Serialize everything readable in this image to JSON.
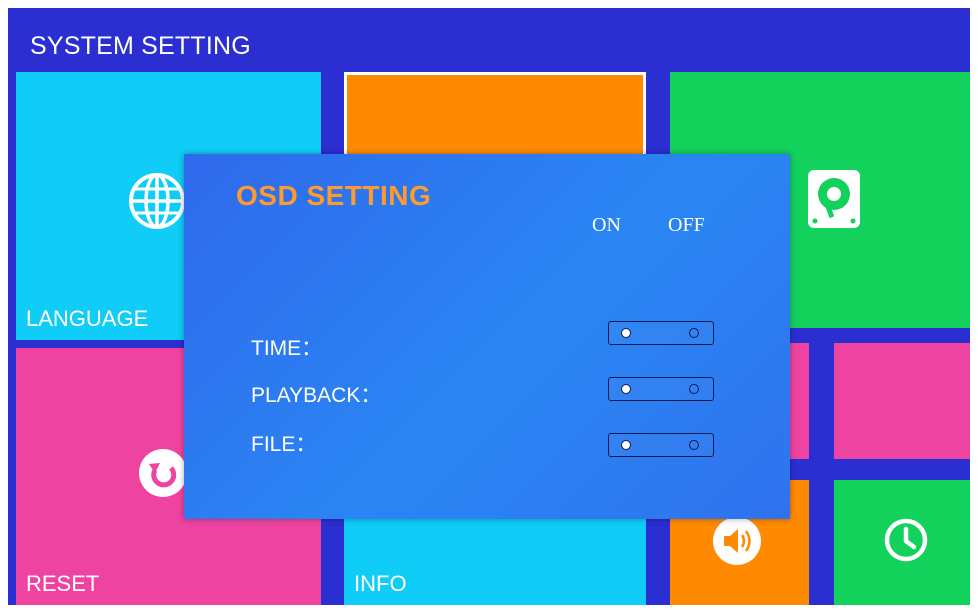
{
  "header": {
    "title": "SYSTEM SETTING"
  },
  "tiles": {
    "language": {
      "label": "LANGUAGE",
      "color": "#0fcdf6",
      "icon": "globe-icon"
    },
    "orange": {
      "color": "#ff8a00"
    },
    "storage": {
      "color": "#12d25c",
      "icon": "hard-drive-icon"
    },
    "reset": {
      "label": "RESET",
      "color": "#ee43a0",
      "icon": "reset-icon"
    },
    "info": {
      "label": "INFO",
      "color": "#0fcdf6"
    },
    "volume": {
      "color": "#ff8a00",
      "icon": "speaker-icon"
    },
    "clock": {
      "color": "#12d25c",
      "icon": "clock-icon"
    }
  },
  "dialog": {
    "title": "OSD SETTING",
    "title_color": "#ff9a2e",
    "col_on": "ON",
    "col_off": "OFF",
    "rows": [
      {
        "label": "TIME：",
        "state": "ON"
      },
      {
        "label": "PLAYBACK：",
        "state": "ON"
      },
      {
        "label": "FILE：",
        "state": "ON"
      }
    ]
  },
  "colors": {
    "background": "#2b2ed0",
    "dialog": "#2a86f3"
  }
}
